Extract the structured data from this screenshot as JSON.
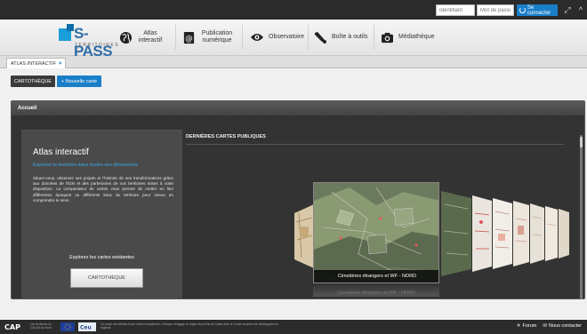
{
  "topbar": {
    "username_placeholder": "Identifiant",
    "password_placeholder": "Mot de passe",
    "connect_label": "Se connecter"
  },
  "brand": {
    "name": "S-PASS",
    "subtitle": "TERRITOIRES"
  },
  "nav": {
    "atlas": "Atlas interactif",
    "publication": "Publication numérique",
    "observatoire": "Observatoire",
    "boite": "Boîte à outils",
    "mediatheque": "Médiathèque"
  },
  "tab": {
    "label": "ATLAS INTERACTIF"
  },
  "toolbar": {
    "cartotheque": "CARTOTHÈQUE",
    "new_map": "+ Nouvelle carte"
  },
  "panel": {
    "title": "Accueil"
  },
  "atlas": {
    "title": "Atlas interactif",
    "tagline": "Explorez le territoire dans toutes ses dimensions",
    "description": "Situez-vous, observez ses projets et l'histoire de ses transformations grâce aux données de l'IGN et des partenaires de vos territoires mises à votre disposition. Le comparateur de cartes vous permet de mettre en lien différentes époques ou différents lieux du territoire pour mieux en comprendre le sens.",
    "explore_label": "Explorez les cartes existantes",
    "button_label": "CARTOTHÈQUE"
  },
  "maps": {
    "heading": "DERNIÈRES CARTES PUBLIQUES",
    "featured_caption": "Cimetières étrangers et WF - NORD"
  },
  "footer": {
    "funding_text": "Ce projet est cofinancé par l'Union européenne. L'Europe s'engage en région Nord-Pas de Calais avec le Fonds européen de développement régional",
    "region_text": "Les territoires du CALAIS au Nord",
    "forum_label": "Forum",
    "contact_label": "Nous contacter"
  },
  "colors": {
    "accent": "#1a7fc9",
    "dark": "#2b2b2b"
  }
}
